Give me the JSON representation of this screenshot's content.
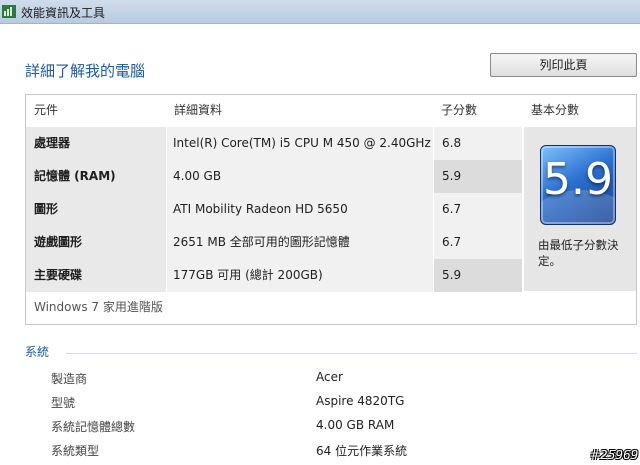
{
  "window": {
    "title": "效能資訊及工具"
  },
  "page": {
    "heading": "詳細了解我的電腦",
    "print_button": "列印此頁"
  },
  "table": {
    "headers": {
      "component": "元件",
      "details": "詳細資料",
      "subscore": "子分數",
      "base_score": "基本分數"
    },
    "rows": [
      {
        "component": "處理器",
        "details": "Intel(R) Core(TM) i5 CPU M 450 @ 2.40GHz",
        "subscore": "6.8"
      },
      {
        "component": "記憶體 (RAM)",
        "details": "4.00 GB",
        "subscore": "5.9"
      },
      {
        "component": "圖形",
        "details": "ATI Mobility Radeon HD 5650",
        "subscore": "6.7"
      },
      {
        "component": "遊戲圖形",
        "details": "2651 MB 全部可用的圖形記憶體",
        "subscore": "6.7"
      },
      {
        "component": "主要硬碟",
        "details": "177GB 可用 (總計 200GB)",
        "subscore": "5.9"
      }
    ],
    "base_score_value": "5.9",
    "base_score_note": "由最低子分數決定。",
    "edition": "Windows 7 家用進階版"
  },
  "system": {
    "header": "系統",
    "items": [
      {
        "label": "製造商",
        "value": "Acer"
      },
      {
        "label": "型號",
        "value": "Aspire 4820TG"
      },
      {
        "label": "系統記憶體總數",
        "value": "4.00 GB RAM"
      },
      {
        "label": "系統類型",
        "value": "64 位元作業系統"
      }
    ]
  },
  "watermark": "#25969",
  "colors": {
    "accent": "#1e5aa0",
    "badge": "#2b6fd0"
  },
  "icons": {
    "app": "performance-info-icon"
  }
}
